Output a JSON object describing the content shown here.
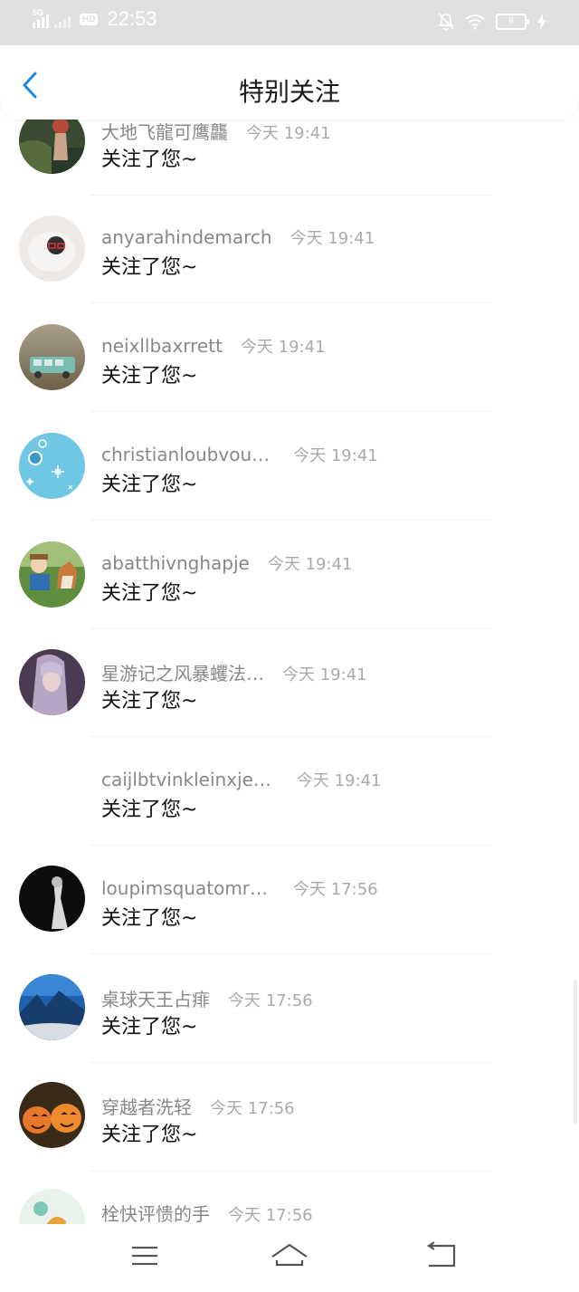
{
  "status_bar": {
    "network": "5G",
    "hd": "HD",
    "time": "22:53",
    "battery": "8"
  },
  "header": {
    "title": "特别关注",
    "back_icon": "chevron-left-icon",
    "accent": "#1e88e5"
  },
  "notifications": [
    {
      "name": "大地飞龍可鹰龘",
      "time": "今天 19:41",
      "message": "关注了您~"
    },
    {
      "name": "anyarahindemarch",
      "time": "今天 19:41",
      "message": "关注了您~"
    },
    {
      "name": "neixllbaxrrett",
      "time": "今天 19:41",
      "message": "关注了您~"
    },
    {
      "name": "christianloubvou…",
      "time": "今天 19:41",
      "message": "关注了您~"
    },
    {
      "name": "abatthivnghapje",
      "time": "今天 19:41",
      "message": "关注了您~"
    },
    {
      "name": "星游记之风暴蠼法…",
      "time": "今天 19:41",
      "message": "关注了您~"
    },
    {
      "name": "caijlbtvinkleinxje…",
      "time": "今天 19:41",
      "message": "关注了您~"
    },
    {
      "name": "loupimsquatomr…",
      "time": "今天 17:56",
      "message": "关注了您~"
    },
    {
      "name": "桌球天王占痱",
      "time": "今天 17:56",
      "message": "关注了您~"
    },
    {
      "name": "穿越者洗轻",
      "time": "今天 17:56",
      "message": "关注了您~"
    },
    {
      "name": "栓快评愦的手",
      "time": "今天 17:56",
      "message": ""
    }
  ],
  "nav_bar": {
    "menu_icon": "menu-icon",
    "home_icon": "home-icon",
    "back_icon": "back-icon"
  }
}
